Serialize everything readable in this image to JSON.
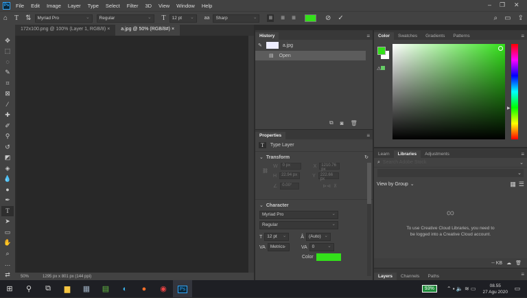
{
  "menu": [
    "File",
    "Edit",
    "Image",
    "Layer",
    "Type",
    "Select",
    "Filter",
    "3D",
    "View",
    "Window",
    "Help"
  ],
  "app_icon": "Ps",
  "options": {
    "font_family": "Myriad Pro",
    "font_style": "Regular",
    "font_size": "12 pt",
    "antialias": "Sharp",
    "color": "#33e01a"
  },
  "tabs": [
    {
      "label": "172x100.png @ 100% (Layer 1, RGB/8)",
      "close": "×"
    },
    {
      "label": "a.jpg @ 50% (RGB/8#)",
      "close": "×"
    }
  ],
  "status": {
    "zoom": "50%",
    "doc": "1295 px x 801 px (144 ppi)"
  },
  "history": {
    "title": "History",
    "snapshot": "a.jpg",
    "items": [
      "Open"
    ]
  },
  "properties": {
    "title": "Properties",
    "layer_type": "Type Layer",
    "transform": "Transform",
    "w_label": "W",
    "h_label": "H",
    "x_label": "X",
    "y_label": "Y",
    "w": "0 px",
    "h": "22.94 px",
    "x": "1210.76 px",
    "y": "222.66 px",
    "angle": "0.00°",
    "character": "Character",
    "font_family": "Myriad Pro",
    "font_style": "Regular",
    "size": "12 pt",
    "leading": "(Auto)",
    "kerning": "Metrics",
    "tracking": "0",
    "color_label": "Color",
    "color": "#33e01a"
  },
  "color_panel": {
    "tabs": [
      "Color",
      "Swatches",
      "Gradients",
      "Patterns"
    ],
    "fg": "#33e01a",
    "bg": "#ffffff"
  },
  "libraries": {
    "tabs": [
      "Learn",
      "Libraries",
      "Adjustments"
    ],
    "search_placeholder": "Search Adobe Stock",
    "view_by": "View by Group",
    "message": "To use Creative Cloud Libraries, you need to be logged into a Creative Cloud account.",
    "size": "-- KB"
  },
  "layers": {
    "tabs": [
      "Layers",
      "Channels",
      "Paths"
    ]
  },
  "taskbar": {
    "battery": "93%",
    "time": "08.55",
    "date": "27 Agu 2020"
  }
}
